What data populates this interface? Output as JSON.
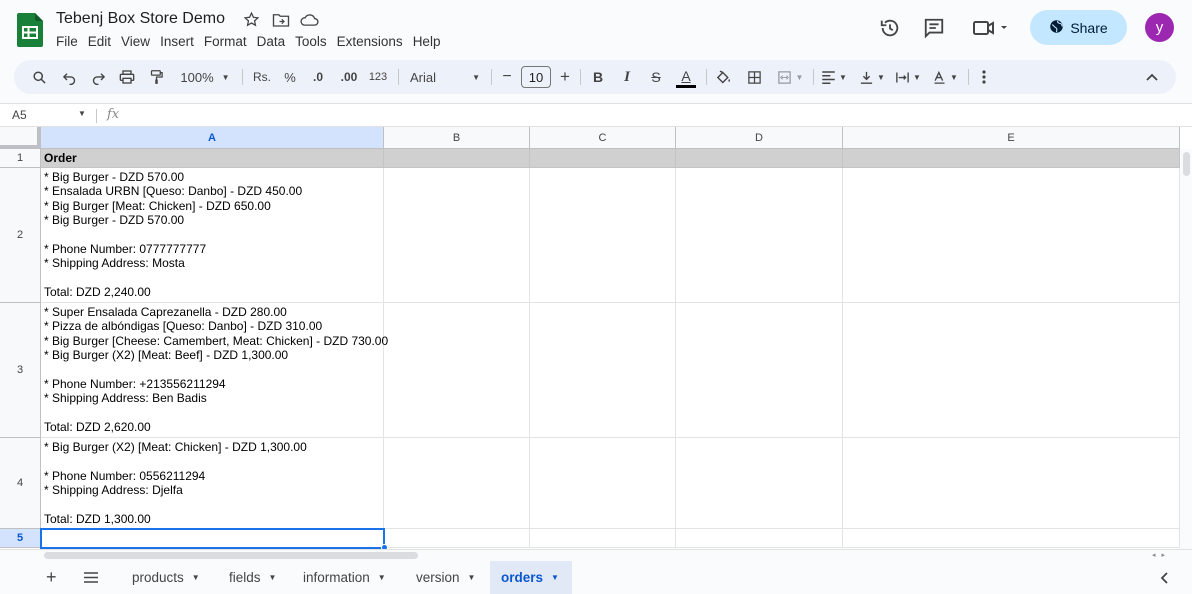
{
  "app": {
    "title": "Tebenj Box Store Demo",
    "menu": [
      "File",
      "Edit",
      "View",
      "Insert",
      "Format",
      "Data",
      "Tools",
      "Extensions",
      "Help"
    ],
    "share_label": "Share",
    "avatar_initial": "y"
  },
  "toolbar": {
    "zoom": "100%",
    "currency": "Rs.",
    "percent": "%",
    "dec_decrease": ".0",
    "dec_increase": ".00",
    "number_format": "123",
    "font": "Arial",
    "font_size": "10",
    "minus": "−",
    "plus": "+",
    "bold": "B",
    "italic": "I",
    "strike": "S",
    "text_color": "A",
    "text_color_swatch": "#000000"
  },
  "formula_bar": {
    "cell_ref": "A5",
    "fx": "fx",
    "value": ""
  },
  "grid": {
    "columns": [
      "A",
      "B",
      "C",
      "D",
      "E"
    ],
    "rows": [
      "1",
      "2",
      "3",
      "4",
      "5"
    ],
    "header_cell": "Order",
    "orders": [
      "* Big Burger - DZD 570.00\n* Ensalada URBN [Queso: Danbo] - DZD 450.00\n* Big Burger [Meat: Chicken] - DZD 650.00\n* Big Burger - DZD 570.00\n\n* Phone Number: 0777777777\n* Shipping Address: Mosta\n\nTotal: DZD 2,240.00",
      "* Super Ensalada Caprezanella - DZD 280.00\n* Pizza de albóndigas [Queso: Danbo] - DZD 310.00\n* Big Burger [Cheese: Camembert, Meat: Chicken] - DZD 730.00\n* Big Burger (X2) [Meat: Beef] - DZD 1,300.00\n\n* Phone Number: +213556211294\n* Shipping Address: Ben Badis\n\nTotal: DZD 2,620.00",
      "* Big Burger (X2) [Meat: Chicken] - DZD 1,300.00\n\n* Phone Number: 0556211294\n* Shipping Address: Djelfa\n\nTotal: DZD 1,300.00"
    ]
  },
  "sheets": {
    "add": "+",
    "tabs": [
      "products",
      "fields",
      "information",
      "version",
      "orders"
    ],
    "active": "orders"
  },
  "colors": {
    "accent": "#1a73e8",
    "share_bg": "#c2e7ff",
    "header_row_bg": "#d0d0d0",
    "avatar_bg": "#9c27b0",
    "logo_green": "#188038"
  }
}
